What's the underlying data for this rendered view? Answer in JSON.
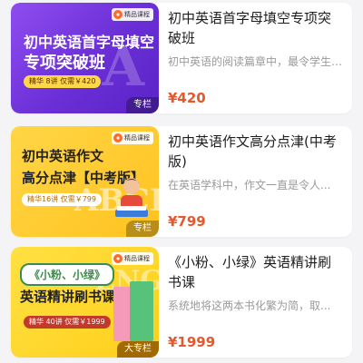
{
  "courses": [
    {
      "thumb_badge": "精品课程",
      "thumb_title_line1": "初中英语首字母填空",
      "thumb_title_line2": "专项突破班",
      "thumb_meta": "精华 8讲 仅需￥420",
      "thumb_tag": "专栏",
      "title": "初中英语首字母填空专项突破班",
      "description": "初中英语的阅读篇章中，最令学生头疼的...",
      "price": "¥420"
    },
    {
      "thumb_badge": "精品课程",
      "thumb_title_line1": "初中英语作文",
      "thumb_title_line2": "高分点津【中考版】",
      "thumb_meta": "精华16讲 仅需￥799",
      "thumb_tag": "专栏",
      "title": "初中英语作文高分点津(中考版)",
      "description": "在英语学科中，作文一直是令人...",
      "price": "¥799"
    },
    {
      "thumb_badge": "精品课程",
      "thumb_bubble": "《小粉、小绿》",
      "thumb_title_line1": "英语精讲刷书课",
      "thumb_meta": "精华 40讲 仅需￥1999",
      "thumb_tag": "大专栏",
      "title": "《小粉、小绿》英语精讲刷书课",
      "description": "系统地将这两本书化繁为简，取...",
      "price": "¥1999"
    }
  ],
  "colors": {
    "price": "#e5582d",
    "card_1_bg": "#7a3ae6",
    "card_2_bg": "#ffc928",
    "card_3_bg": "#ffd62e"
  }
}
